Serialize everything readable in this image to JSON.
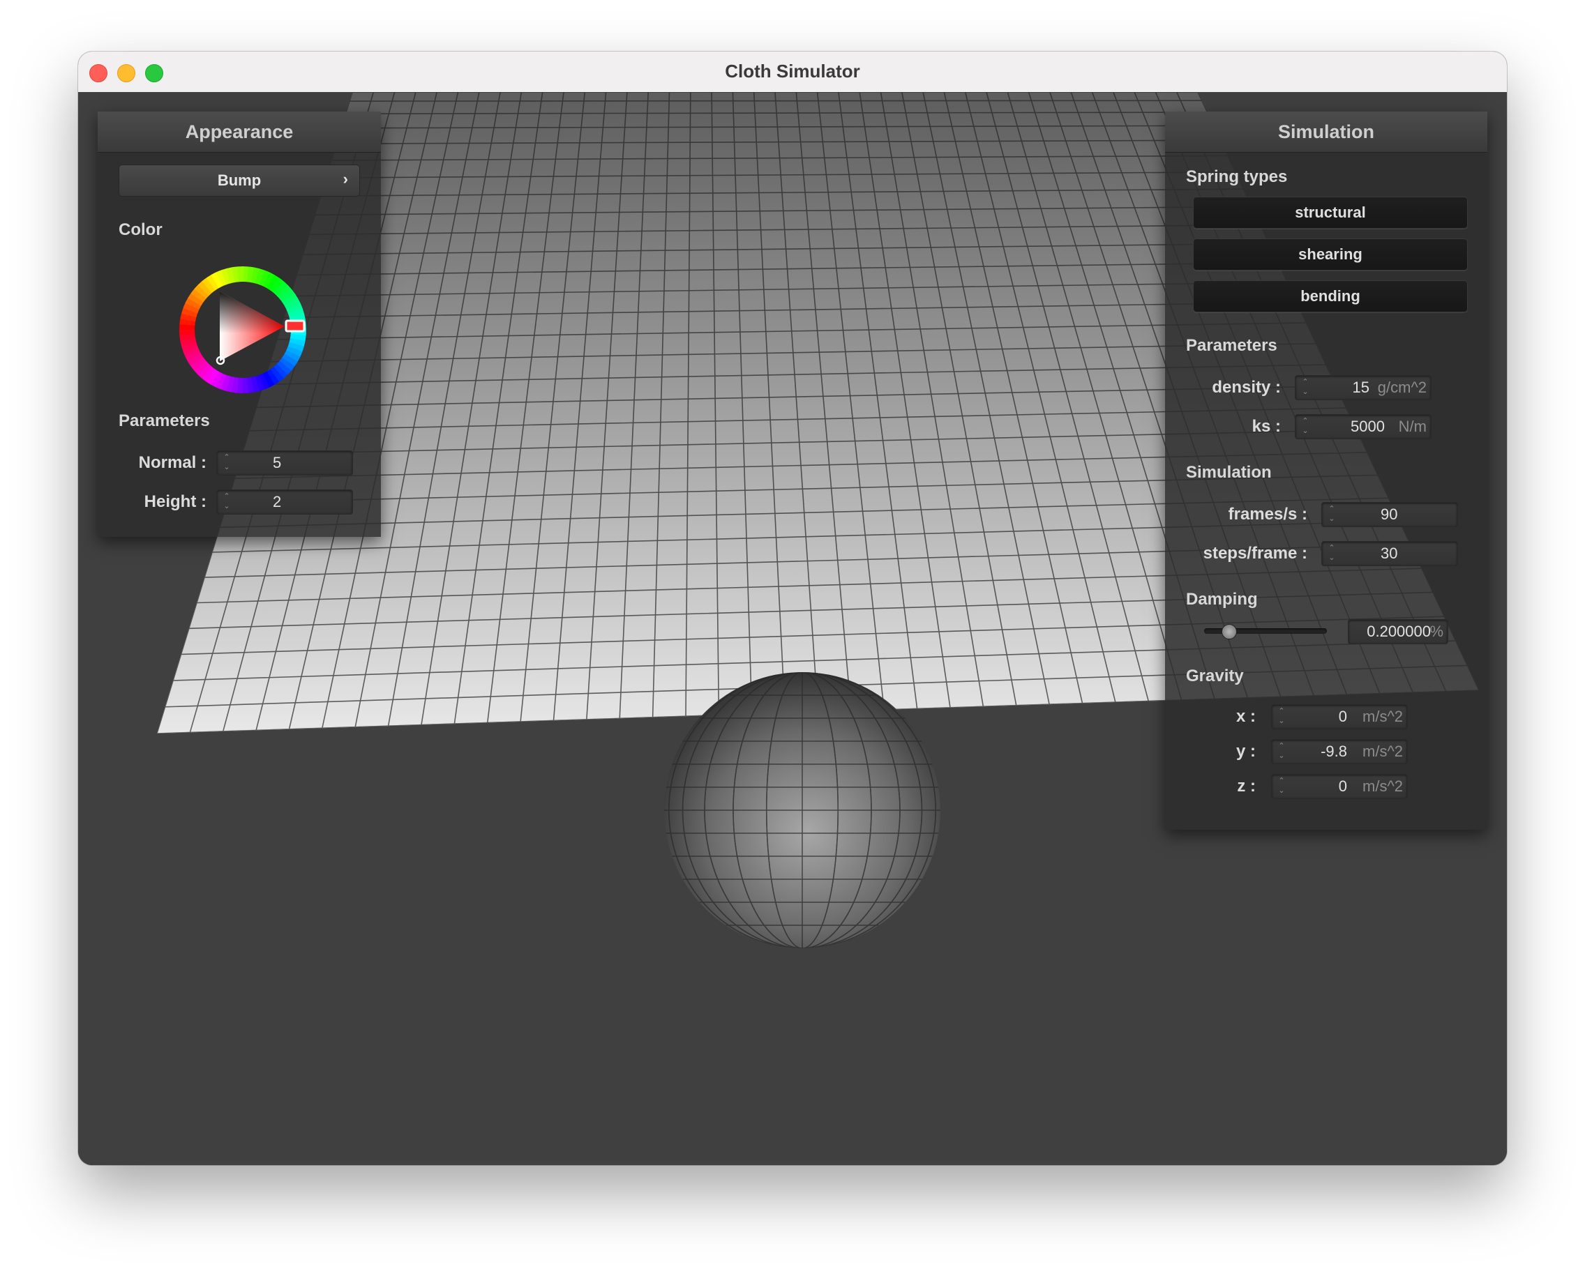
{
  "window": {
    "title": "Cloth Simulator"
  },
  "appearance_panel": {
    "title": "Appearance",
    "shader_dropdown": {
      "selected": "Bump",
      "chevron": "›"
    },
    "color_label": "Color",
    "parameters_label": "Parameters",
    "normal": {
      "label": "Normal :",
      "value": "5"
    },
    "height": {
      "label": "Height :",
      "value": "2"
    },
    "selected_hue_color": "#ff0000"
  },
  "simulation_panel": {
    "title": "Simulation",
    "spring_types": {
      "label": "Spring types",
      "buttons": [
        "structural",
        "shearing",
        "bending"
      ]
    },
    "parameters": {
      "label": "Parameters",
      "density": {
        "label": "density :",
        "value": "15",
        "unit": "g/cm^2"
      },
      "ks": {
        "label": "ks :",
        "value": "5000",
        "unit": "N/m"
      }
    },
    "simulation": {
      "label": "Simulation",
      "frames": {
        "label": "frames/s :",
        "value": "90"
      },
      "steps": {
        "label": "steps/frame :",
        "value": "30"
      }
    },
    "damping": {
      "label": "Damping",
      "value": "0.200000",
      "unit": "%",
      "slider_fraction": 0.2
    },
    "gravity": {
      "label": "Gravity",
      "x": {
        "label": "x :",
        "value": "0",
        "unit": "m/s^2"
      },
      "y": {
        "label": "y :",
        "value": "-9.8",
        "unit": "m/s^2"
      },
      "z": {
        "label": "z :",
        "value": "0",
        "unit": "m/s^2"
      }
    }
  },
  "colors": {
    "background": "#404040",
    "panel": "#2c2c2c",
    "accent_red": "#ff3b30"
  }
}
